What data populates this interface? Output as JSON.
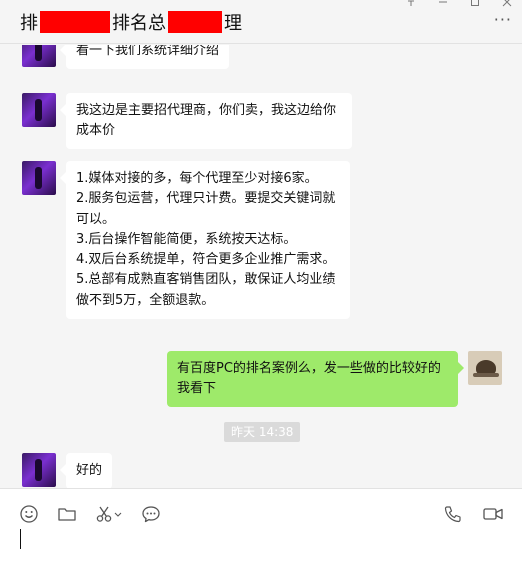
{
  "header": {
    "title_part1": "排",
    "title_part2": "排名总",
    "title_part3": "理",
    "more_label": "···"
  },
  "window_controls": [
    "pin-icon",
    "minimize-icon",
    "maximize-icon",
    "close-icon"
  ],
  "messages": [
    {
      "side": "left",
      "text": "看一下我们系统详细介绍"
    },
    {
      "side": "left",
      "text": "我这边是主要招代理商，你们卖，我这边给你成本价"
    },
    {
      "side": "left",
      "lines": [
        "1.媒体对接的多，每个代理至少对接6家。",
        "2.服务包运营，代理只计费。要提交关键词就可以。",
        "3.后台操作智能简便，系统按天达标。",
        "4.双后台系统提单，符合更多企业推广需求。",
        "5.总部有成熟直客销售团队，敢保证人均业绩做不到5万，全额退款。"
      ]
    },
    {
      "side": "right",
      "text": "有百度PC的排名案例么，发一些做的比较好的我看下"
    },
    {
      "side": "left",
      "text": "好的"
    }
  ],
  "timestamp": "昨天 14:38",
  "toolbar": {
    "left_icons": [
      "emoji-icon",
      "folder-icon",
      "scissors-icon",
      "chat-bubble-icon"
    ],
    "right_icons": [
      "phone-icon",
      "video-icon"
    ]
  },
  "colors": {
    "redaction": "#ff0000",
    "outgoing_bubble": "#9eea6a",
    "incoming_bubble": "#ffffff",
    "chat_background": "#f5f5f5"
  }
}
